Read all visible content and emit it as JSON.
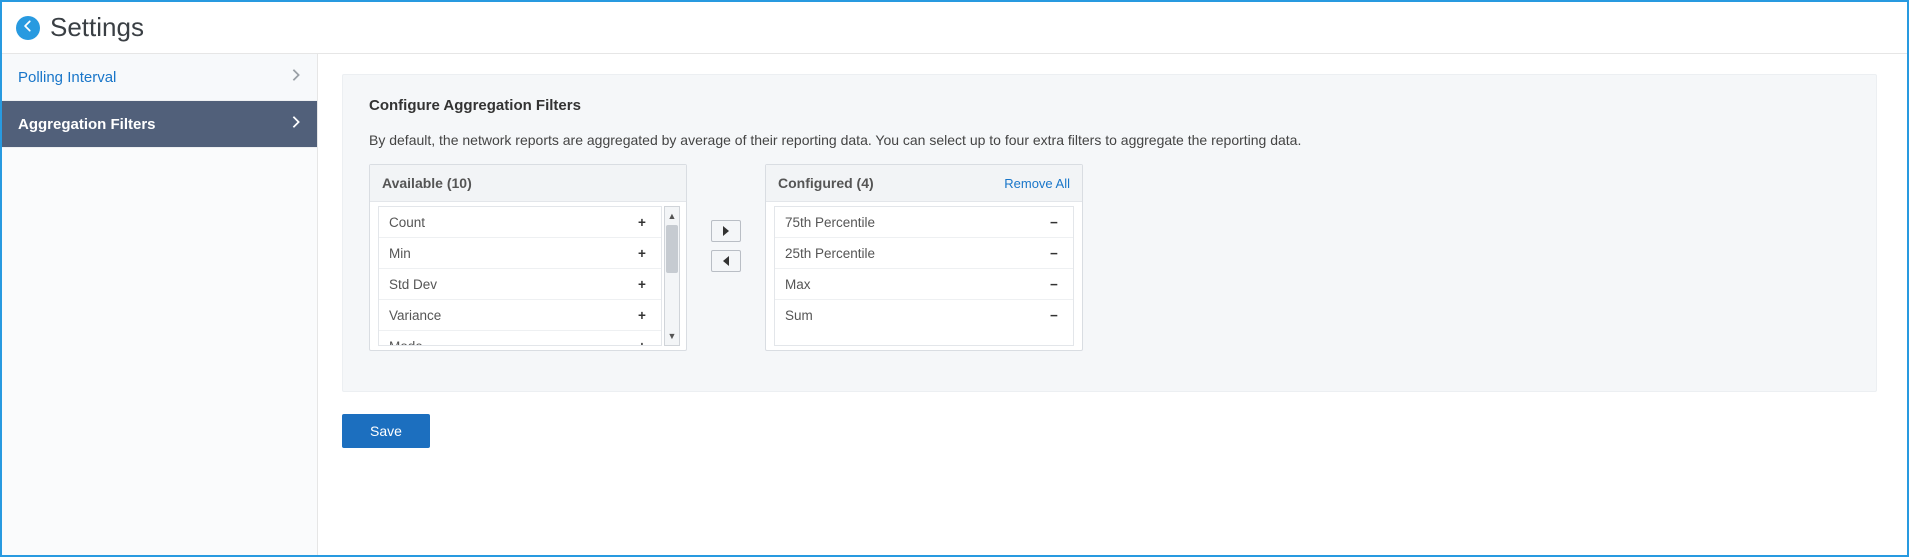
{
  "header": {
    "title": "Settings"
  },
  "sidebar": {
    "items": [
      {
        "label": "Polling Interval",
        "active": false
      },
      {
        "label": "Aggregation Filters",
        "active": true
      }
    ]
  },
  "panel": {
    "title": "Configure Aggregation Filters",
    "description": "By default, the network reports are aggregated by average of their reporting data. You can select up to four extra filters to aggregate the reporting data."
  },
  "available": {
    "heading": "Available (10)",
    "items": [
      "Count",
      "Min",
      "Std Dev",
      "Variance",
      "Mode"
    ]
  },
  "configured": {
    "heading": "Configured (4)",
    "remove_all": "Remove All",
    "items": [
      "75th Percentile",
      "25th Percentile",
      "Max",
      "Sum"
    ]
  },
  "actions": {
    "save": "Save"
  }
}
